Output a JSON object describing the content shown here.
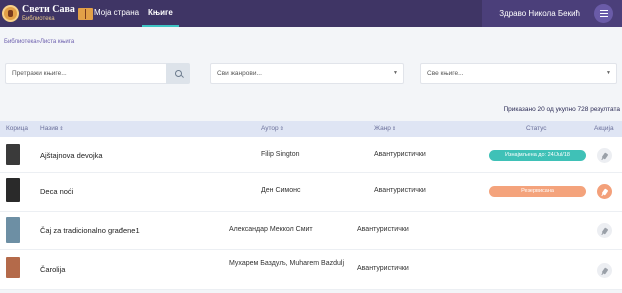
{
  "app": {
    "logo_title": "Свети Сава",
    "logo_subtitle": "Библиотека"
  },
  "nav": {
    "items": [
      {
        "label": "Моја страна"
      },
      {
        "label": "Књиге"
      }
    ],
    "greeting": "Здраво Никола Бекић"
  },
  "breadcrumb": "Библиотека»Листа књига",
  "filters": {
    "search_placeholder": "Претражи књиге...",
    "genre_placeholder": "Сви жанрови...",
    "books_placeholder": "Све књиге...",
    "caret": "▼"
  },
  "summary": "Приказано 20 од укупно 728 резултата",
  "table": {
    "headers": {
      "cover": "Корица",
      "title": "Назив",
      "author": "Аутор",
      "genre": "Жанр",
      "status": "Статус",
      "action": "Акција"
    },
    "sort_glyph": "⇕",
    "rows": [
      {
        "title": "Ajštajnova devojka",
        "author": "Filip Sington",
        "genre": "Авантуристички",
        "status": "Изнајмљена до: 24/Jul/18",
        "status_color": "#3fc1b7",
        "action_active": false,
        "cover_color": "#3a3a3a"
      },
      {
        "title": "Deca noći",
        "author": "Ден Симонс",
        "genre": "Авантуристички",
        "status": "Резервисана",
        "status_color": "#f4a37c",
        "action_active": true,
        "cover_color": "#2a2a2a"
      },
      {
        "title": "Čaj za tradicionalno građene1",
        "author": "Александар Меккол Смит",
        "genre": "Авантуристички",
        "status": "",
        "status_color": "",
        "action_active": false,
        "cover_color": "#6d8fa4"
      },
      {
        "title": "Čarolija",
        "author": "Мухарем Баздуљ, Muharem Bazdulj",
        "genre": "Авантуристички",
        "status": "",
        "status_color": "",
        "action_active": false,
        "cover_color": "#b46a4a"
      }
    ]
  }
}
